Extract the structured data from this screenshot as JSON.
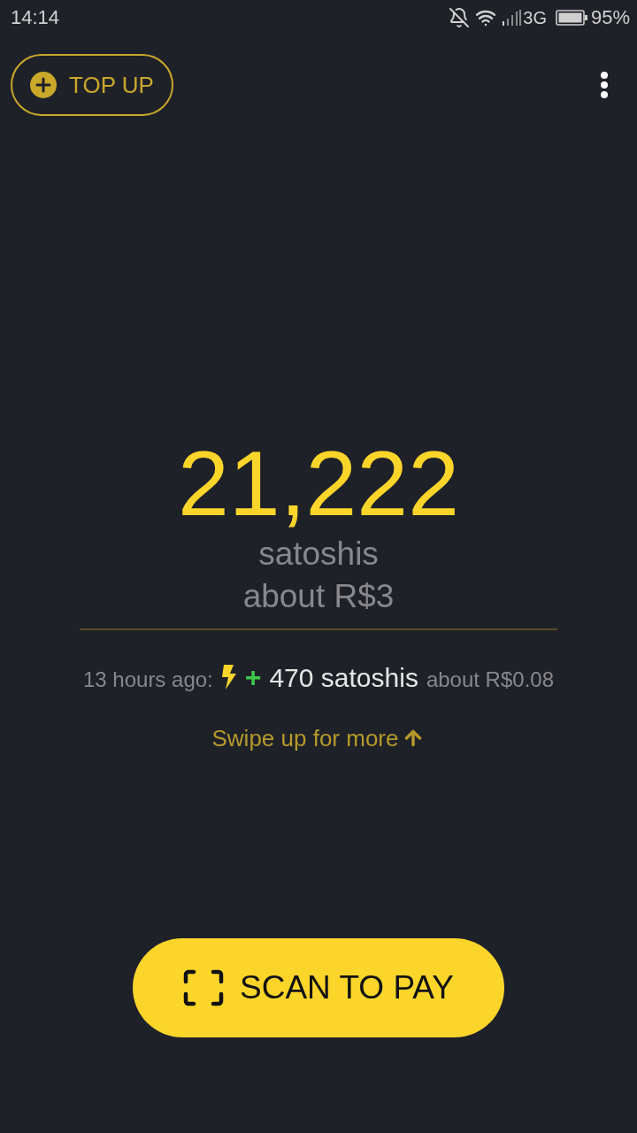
{
  "status_bar": {
    "time": "14:14",
    "network": "3G",
    "battery": "95%"
  },
  "header": {
    "top_up_button": "TOP UP"
  },
  "balance": {
    "amount": "21,222",
    "unit": "satoshis",
    "fiat": "about R$3"
  },
  "last_transaction": {
    "time": "13 hours ago:",
    "kind": "lightning",
    "sign": "+",
    "amount": "470 satoshis",
    "fiat": "about R$0.08"
  },
  "swipe_hint": "Swipe up for more",
  "scan_button": "SCAN TO PAY"
}
